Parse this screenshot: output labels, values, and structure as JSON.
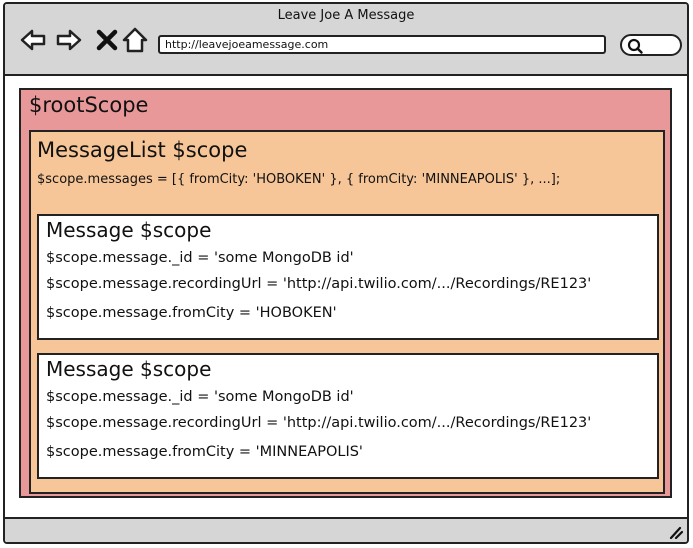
{
  "window": {
    "title": "Leave Joe A Message",
    "url": "http://leavejoeamessage.com"
  },
  "toolbar": {
    "icons": [
      "back-icon",
      "forward-icon",
      "close-icon",
      "home-icon",
      "search-icon",
      "resize-grip-icon"
    ]
  },
  "colors": {
    "root_scope": "#e9989a",
    "message_list_scope": "#f7c698",
    "message_scope": "#ffffff",
    "chrome": "#d6d6d6"
  },
  "root": {
    "title": "$rootScope"
  },
  "message_list": {
    "title": "MessageList $scope",
    "code": "$scope.messages = [{ fromCity: 'HOBOKEN' }, { fromCity: 'MINNEAPOLIS' }, ...];"
  },
  "messages": [
    {
      "title": "Message $scope",
      "id_line": "$scope.message._id = 'some MongoDB id'",
      "url_line": "$scope.message.recordingUrl = 'http://api.twilio.com/.../Recordings/RE123'",
      "city_line": "$scope.message.fromCity = 'HOBOKEN'"
    },
    {
      "title": "Message $scope",
      "id_line": "$scope.message._id = 'some MongoDB id'",
      "url_line": "$scope.message.recordingUrl = 'http://api.twilio.com/.../Recordings/RE123'",
      "city_line": "$scope.message.fromCity = 'MINNEAPOLIS'"
    }
  ]
}
